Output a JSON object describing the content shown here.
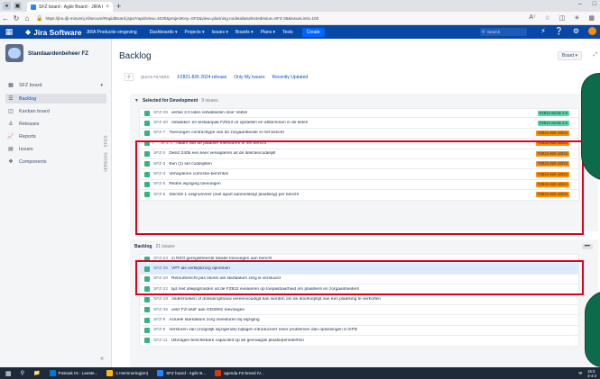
{
  "browser": {
    "tab_title": "SFZ board - Agile Board - JIRA F",
    "url": "https://jira.dji-minvenj.nl/secure/RapidBoard.jspa?rapidView=4030&projectKey=SFZ&view=planning.nodetail&selectedIssue=SFZ-36&issueLimit=100"
  },
  "jira": {
    "logo": "Jira Software",
    "subtitle": "JIRA Productie omgeving",
    "menu": [
      "Dashboards ▾",
      "Projects ▾",
      "Issues ▾",
      "Boards ▾",
      "Plans ▾",
      "Tests"
    ],
    "create": "Create",
    "search_placeholder": "Search"
  },
  "sidebar": {
    "project_name": "Standaardenbeheer FZ",
    "items": [
      {
        "label": "SFZ board",
        "icon": "board-icon"
      },
      {
        "label": "Backlog",
        "icon": "backlog-icon"
      },
      {
        "label": "Kanban board",
        "icon": "kanban-icon"
      },
      {
        "label": "Releases",
        "icon": "ship-icon"
      },
      {
        "label": "Reports",
        "icon": "chart-icon"
      },
      {
        "label": "Issues",
        "icon": "issues-icon"
      },
      {
        "label": "Components",
        "icon": "puzzle-icon"
      }
    ],
    "vertical_tabs": [
      "VERSIONS",
      "EPICS"
    ]
  },
  "backlog": {
    "title": "Backlog",
    "board_button": "Board ▾",
    "quick_filters_label": "QUICK FILTERS:",
    "quick_filters": [
      "FZ821-826 2024 release",
      "Only My Issues",
      "Recently Updated"
    ],
    "selected_sprint": {
      "name": "Selected for Development",
      "count": "9 issues",
      "issues": [
        {
          "key": "SFZ-29",
          "summary": "versie 2.0 laten ontwikkelen door Vektis",
          "version": "FZ813 versie 2.0",
          "color": "green",
          "prio": false
        },
        {
          "key": "SFZ-30",
          "summary": "ontwikkel- en testaanpak FZ813 v2 opstellen en afstemmen in de keten",
          "version": "FZ813 versie 2.0",
          "color": "green",
          "prio": false
        },
        {
          "key": "SFZ-7",
          "summary": "Toevoegen contracttype van de zorgaanbieder in het bericht",
          "version": "FZ821-826 v2024",
          "color": "orange",
          "prio": false
        },
        {
          "key": "SFZ-1",
          "summary": "Naam van de plaatser meesturen in het bericht",
          "version": "FZ821-826 v2024",
          "color": "orange",
          "prio": true
        },
        {
          "key": "SFZ-2",
          "summary": "Delict 240b een keer verwijderen uit de delictencodelijst",
          "version": "FZ821-826 v2024",
          "color": "orange",
          "prio": false
        },
        {
          "key": "SFZ-3",
          "summary": "Een (1) set codelijsten",
          "version": "FZ821-826 v2024",
          "color": "orange",
          "prio": false
        },
        {
          "key": "SFZ-4",
          "summary": "Verwijderen correctie-berichten",
          "version": "FZ821-826 v2024",
          "color": "orange",
          "prio": false
        },
        {
          "key": "SFZ-5",
          "summary": "Reden wijziging toevoegen",
          "version": "FZ821-826 v2024",
          "color": "orange",
          "prio": false
        },
        {
          "key": "SFZ-6",
          "summary": "Slechts 1 volgnummer (niet apart aanmelding/ plaatsing) per bericht",
          "version": "FZ821-826 v2024",
          "color": "orange",
          "prio": false
        }
      ]
    },
    "backlog_sprint": {
      "name": "Backlog",
      "count": "21 issues",
      "more": "•••",
      "issues": [
        {
          "key": "SFZ-23",
          "summary": "in RZO geregistreerde lokatie toevoegen aan bericht",
          "sel": false
        },
        {
          "key": "SFZ-36",
          "summary": "VPT als verblijfszorg opnemen",
          "sel": true
        },
        {
          "key": "SFZ-10",
          "summary": "Retourbericht pas sturen als startdatum zorg is verstuurd",
          "sel": false
        },
        {
          "key": "SFZ-22",
          "summary": "tijd met afwijsgronden uit de FZ822 evalueren op toepasbaarheid om plaatsers en zorgaanbieders",
          "sel": false
        },
        {
          "key": "SFZ-19",
          "summary": "onderzoeken of dossieropbouw vereenvoudigd kan worden om de doorlooptijd van een plaatsing te verkorten",
          "sel": false
        },
        {
          "key": "SFZ-35",
          "summary": "veld 'FZ-intel' aan GDS801 toevoegen",
          "sel": false
        },
        {
          "key": "SFZ-8",
          "summary": "Actuele startdatum zorg meesturen bij wijziging",
          "sel": false
        },
        {
          "key": "SFZ-9",
          "summary": "Versturen van (mogelijk wijzigende) bijlagen introduceert meer problemen dan oplossingen in EPD",
          "sel": false
        },
        {
          "key": "SFZ-11",
          "summary": "Uitvragen beschikbare capaciteit op de gevraagde plaats/periode/fsm",
          "sel": false
        }
      ]
    }
  },
  "taskbar": {
    "apps": [
      {
        "label": "Postvak IN - Leeste...",
        "color": "#0078d4"
      },
      {
        "label": "1 Herinnering(en)",
        "color": "#ffb900"
      },
      {
        "label": "SFZ board - Agile B...",
        "color": "#2684ff"
      },
      {
        "label": "agenda FZ-breed IV...",
        "color": "#d83b01"
      }
    ],
    "time": "15:3",
    "date": "4-4-2"
  }
}
